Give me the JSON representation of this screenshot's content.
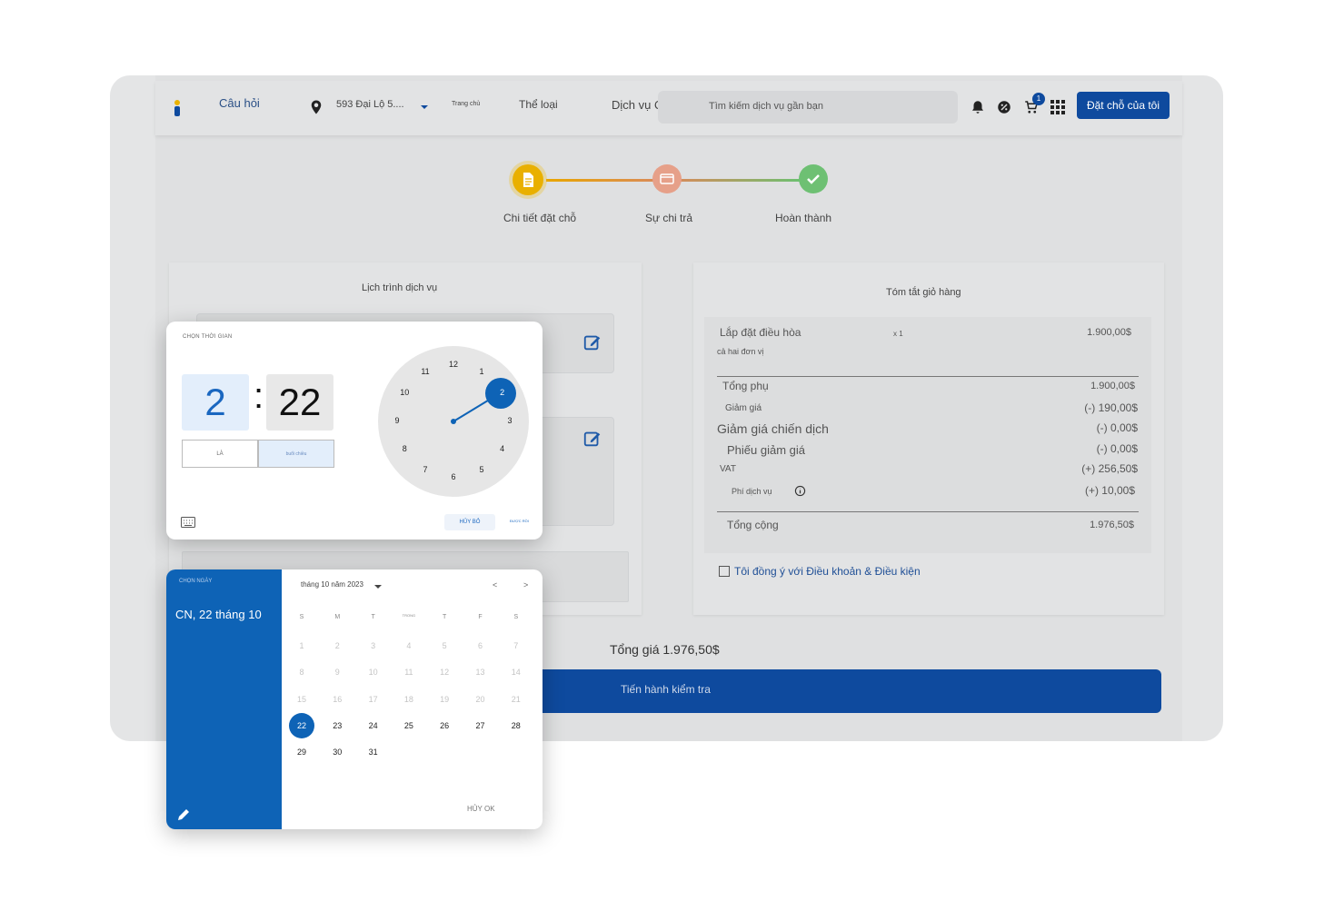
{
  "navbar": {
    "faq": "Câu hỏi",
    "location": "593 Đại Lộ 5....",
    "home": "Trang chủ",
    "category": "Thể loại",
    "services": "Dịch vụ Q",
    "search_placeholder": "Tìm kiếm dịch vụ gần bạn",
    "cart_count": "1",
    "book_button": "Đặt chỗ của tôi"
  },
  "stepper": {
    "step1": "Chi tiết đặt chỗ",
    "step2": "Sự chi trả",
    "step3": "Hoàn thành"
  },
  "schedule": {
    "title": "Lịch trình dịch vụ"
  },
  "summary": {
    "title": "Tóm tắt giỏ hàng",
    "item_name": "Lắp đặt điều hòa",
    "item_qty": "x 1",
    "item_price": "1.900,00$",
    "item_note": "cả hai đơn vị",
    "subtotal_label": "Tổng phụ",
    "subtotal_value": "1.900,00$",
    "discount_label": "Giảm giá",
    "discount_value": "(-) 190,00$",
    "campaign_label": "Giảm giá chiến dịch",
    "campaign_value": "(-) 0,00$",
    "coupon_label": "Phiếu giảm giá",
    "coupon_value": "(-) 0,00$",
    "vat_label": "VAT",
    "vat_value": "(+) 256,50$",
    "fee_label": "Phí dịch vụ",
    "fee_value": "(+) 10,00$",
    "total_label": "Tổng cộng",
    "total_value": "1.976,50$",
    "terms": "Tôi đồng ý với Điều khoản & Điều kiện"
  },
  "footer": {
    "total_price": "Tổng giá 1.976,50$",
    "checkout": "Tiến hành kiểm tra"
  },
  "time_picker": {
    "title": "CHỌN THỜI GIAN",
    "hour": "2",
    "minute": "22",
    "am": "LÀ",
    "pm": "buổi chiều",
    "cancel": "HỦY BỎ",
    "ok": "ĐƯỢC RỒI",
    "clock_numbers": [
      "12",
      "1",
      "2",
      "3",
      "4",
      "5",
      "6",
      "7",
      "8",
      "9",
      "10",
      "11"
    ],
    "selected_hour": 2
  },
  "date_picker": {
    "side_title": "CHỌN NGÀY",
    "selected_date": "CN, 22 tháng 10",
    "month_label": "tháng 10 năm 2023",
    "prev": "<",
    "next": ">",
    "weekdays": [
      "S",
      "M",
      "T",
      "TRONG",
      "T",
      "F",
      "S"
    ],
    "days": [
      [
        "1",
        "2",
        "3",
        "4",
        "5",
        "6",
        "7"
      ],
      [
        "8",
        "9",
        "10",
        "11",
        "12",
        "13",
        "14"
      ],
      [
        "15",
        "16",
        "17",
        "18",
        "19",
        "20",
        "21"
      ],
      [
        "22",
        "23",
        "24",
        "25",
        "26",
        "27",
        "28"
      ],
      [
        "29",
        "30",
        "31"
      ]
    ],
    "selected_day": "22",
    "actions": "HỦY OK"
  },
  "colors": {
    "primary": "#0e4a9e",
    "picker_blue": "#0e63b6",
    "step1": "#f2b705",
    "step2": "#e8967a",
    "step3": "#6cc070"
  }
}
